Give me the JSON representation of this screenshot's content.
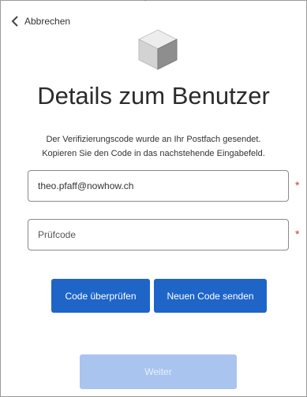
{
  "header": {
    "top_glyph": "ˇ",
    "back_label": "Abbrechen"
  },
  "page": {
    "title": "Details zum Benutzer",
    "description_line1": "Der Verifizierungscode wurde an Ihr Postfach gesendet.",
    "description_line2": "Kopieren Sie den Code in das nachstehende Eingabefeld."
  },
  "form": {
    "email": {
      "value": "theo.pfaff@nowhow.ch",
      "required_mark": "*"
    },
    "code": {
      "value": "",
      "placeholder": "Prüfcode",
      "required_mark": "*"
    }
  },
  "buttons": {
    "verify_label": "Code überprüfen",
    "resend_label": "Neuen Code senden",
    "next_label": "Weiter"
  },
  "colors": {
    "primary": "#1f65c8",
    "disabled": "#a9c4ee",
    "required": "#d13438"
  },
  "icons": {
    "back": "chevron-left-icon",
    "logo": "cube-icon"
  }
}
